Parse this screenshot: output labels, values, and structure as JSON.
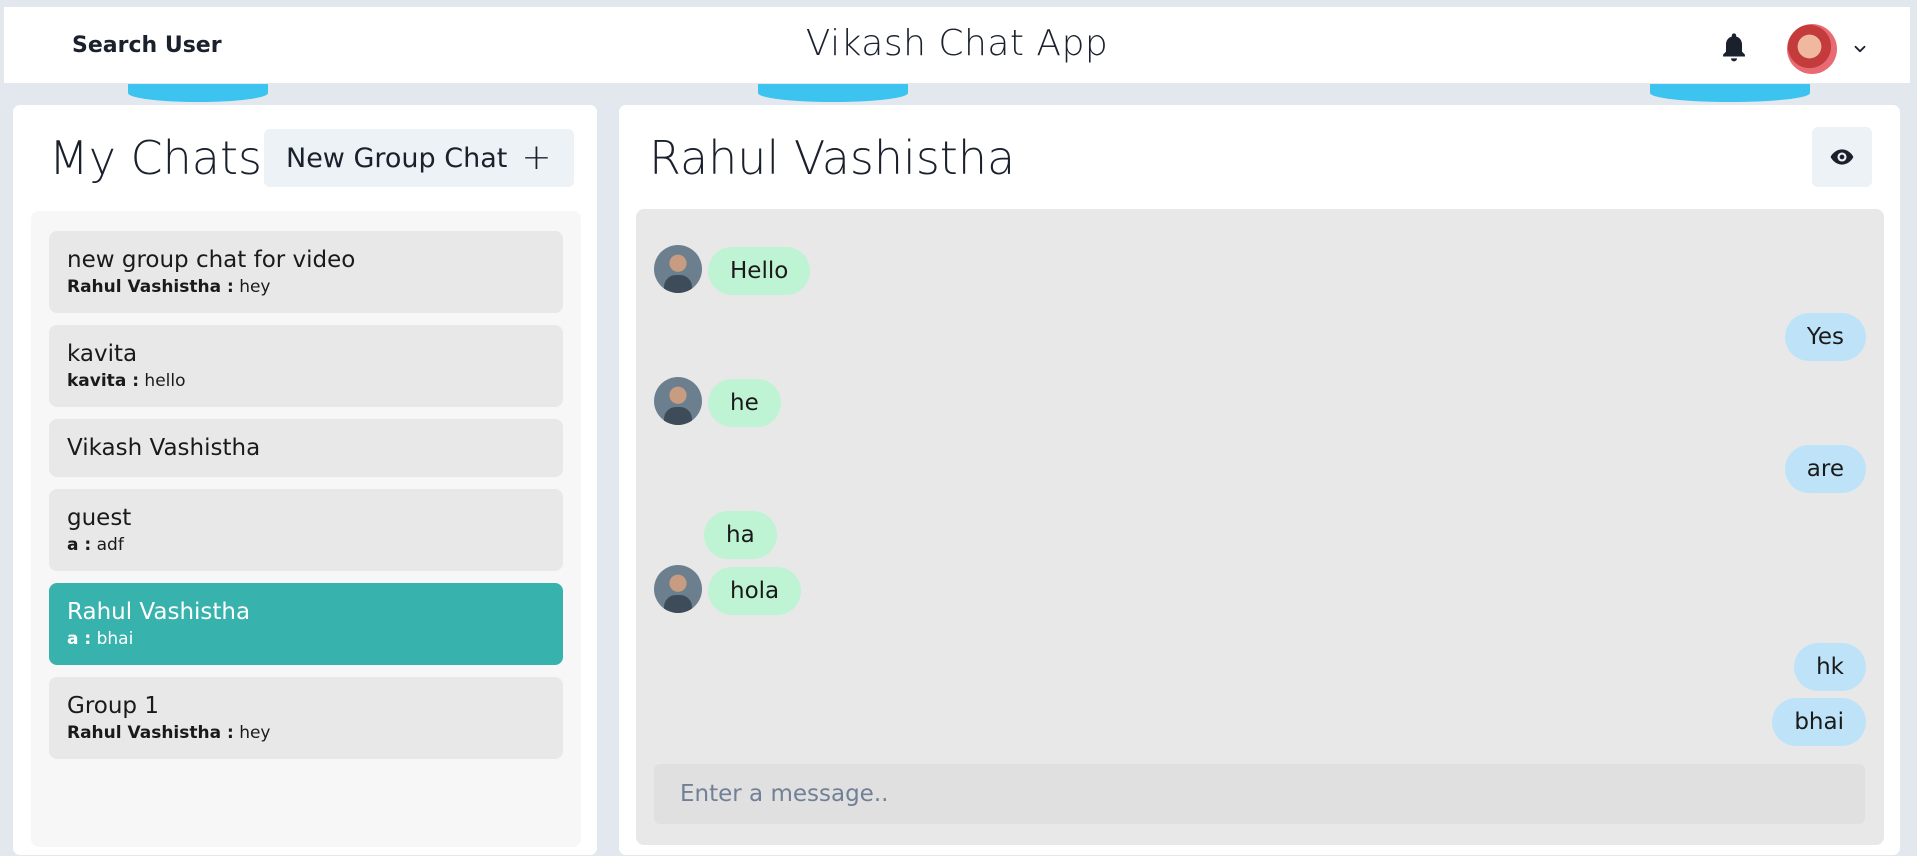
{
  "header": {
    "search_label": "Search User",
    "app_title": "Vikash Chat App"
  },
  "sidebar": {
    "title": "My Chats",
    "new_group_label": "New Group Chat",
    "chats": [
      {
        "name": "new group chat for video",
        "sender": "Rahul Vashistha :",
        "message": "hey"
      },
      {
        "name": "kavita",
        "sender": "kavita :",
        "message": "hello"
      },
      {
        "name": "Vikash Vashistha",
        "sender": "",
        "message": ""
      },
      {
        "name": "guest",
        "sender": "a :",
        "message": "adf"
      },
      {
        "name": "Rahul Vashistha",
        "sender": "a :",
        "message": "bhai"
      },
      {
        "name": "Group 1",
        "sender": "Rahul Vashistha :",
        "message": "hey"
      }
    ]
  },
  "chat": {
    "title": "Rahul Vashistha",
    "messages": [
      {
        "text": "Hello",
        "from": "them"
      },
      {
        "text": "Yes",
        "from": "me"
      },
      {
        "text": "he",
        "from": "them"
      },
      {
        "text": "are",
        "from": "me"
      },
      {
        "text": "ha",
        "from": "them"
      },
      {
        "text": "hola",
        "from": "them"
      },
      {
        "text": "hk",
        "from": "me"
      },
      {
        "text": "bhai",
        "from": "me"
      }
    ],
    "input_placeholder": "Enter a message.."
  },
  "colors": {
    "active_chat": "#38b2ac",
    "bubble_them": "#bef3d4",
    "bubble_me": "#bee3f8"
  }
}
